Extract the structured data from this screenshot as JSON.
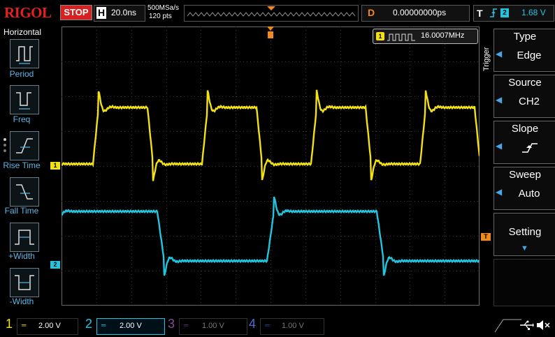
{
  "brand": "RIGOL",
  "run_state": "STOP",
  "horizontal": {
    "label": "H",
    "timebase": "20.0ns",
    "sample_rate": "500MSa/s",
    "mem_depth": "120 pts"
  },
  "delay": {
    "label": "D",
    "value": "0.00000000ps"
  },
  "trigger_status": {
    "label": "T",
    "source": "2",
    "level": "1.68 V"
  },
  "left_menu": {
    "title": "Horizontal",
    "items": [
      "Period",
      "Freq",
      "Rise Time",
      "Fall Time",
      "+Width",
      "-Width"
    ]
  },
  "measurement": {
    "channel": "1",
    "value": "16.0007MHz"
  },
  "trigger_menu": {
    "side_label": "Trigger",
    "type_label": "Type",
    "type_value": "Edge",
    "source_label": "Source",
    "source_value": "CH2",
    "slope_label": "Slope",
    "sweep_label": "Sweep",
    "sweep_value": "Auto",
    "settings_label": "Setting"
  },
  "channels": [
    {
      "num": "1",
      "scale": "2.00 V",
      "color": "#f2e214"
    },
    {
      "num": "2",
      "scale": "2.00 V",
      "color": "#22c5e0"
    },
    {
      "num": "3",
      "scale": "1.00 V",
      "color": "#8a4a9a"
    },
    {
      "num": "4",
      "scale": "1.00 V",
      "color": "#2a4aa6"
    }
  ],
  "marker_labels": {
    "ch1": "1",
    "ch2": "2",
    "trigger": "T"
  },
  "colors": {
    "ch1": "#f2e214",
    "ch2": "#22c5e0",
    "accent": "#f28a1a",
    "grid": "#6a6a6a"
  }
}
